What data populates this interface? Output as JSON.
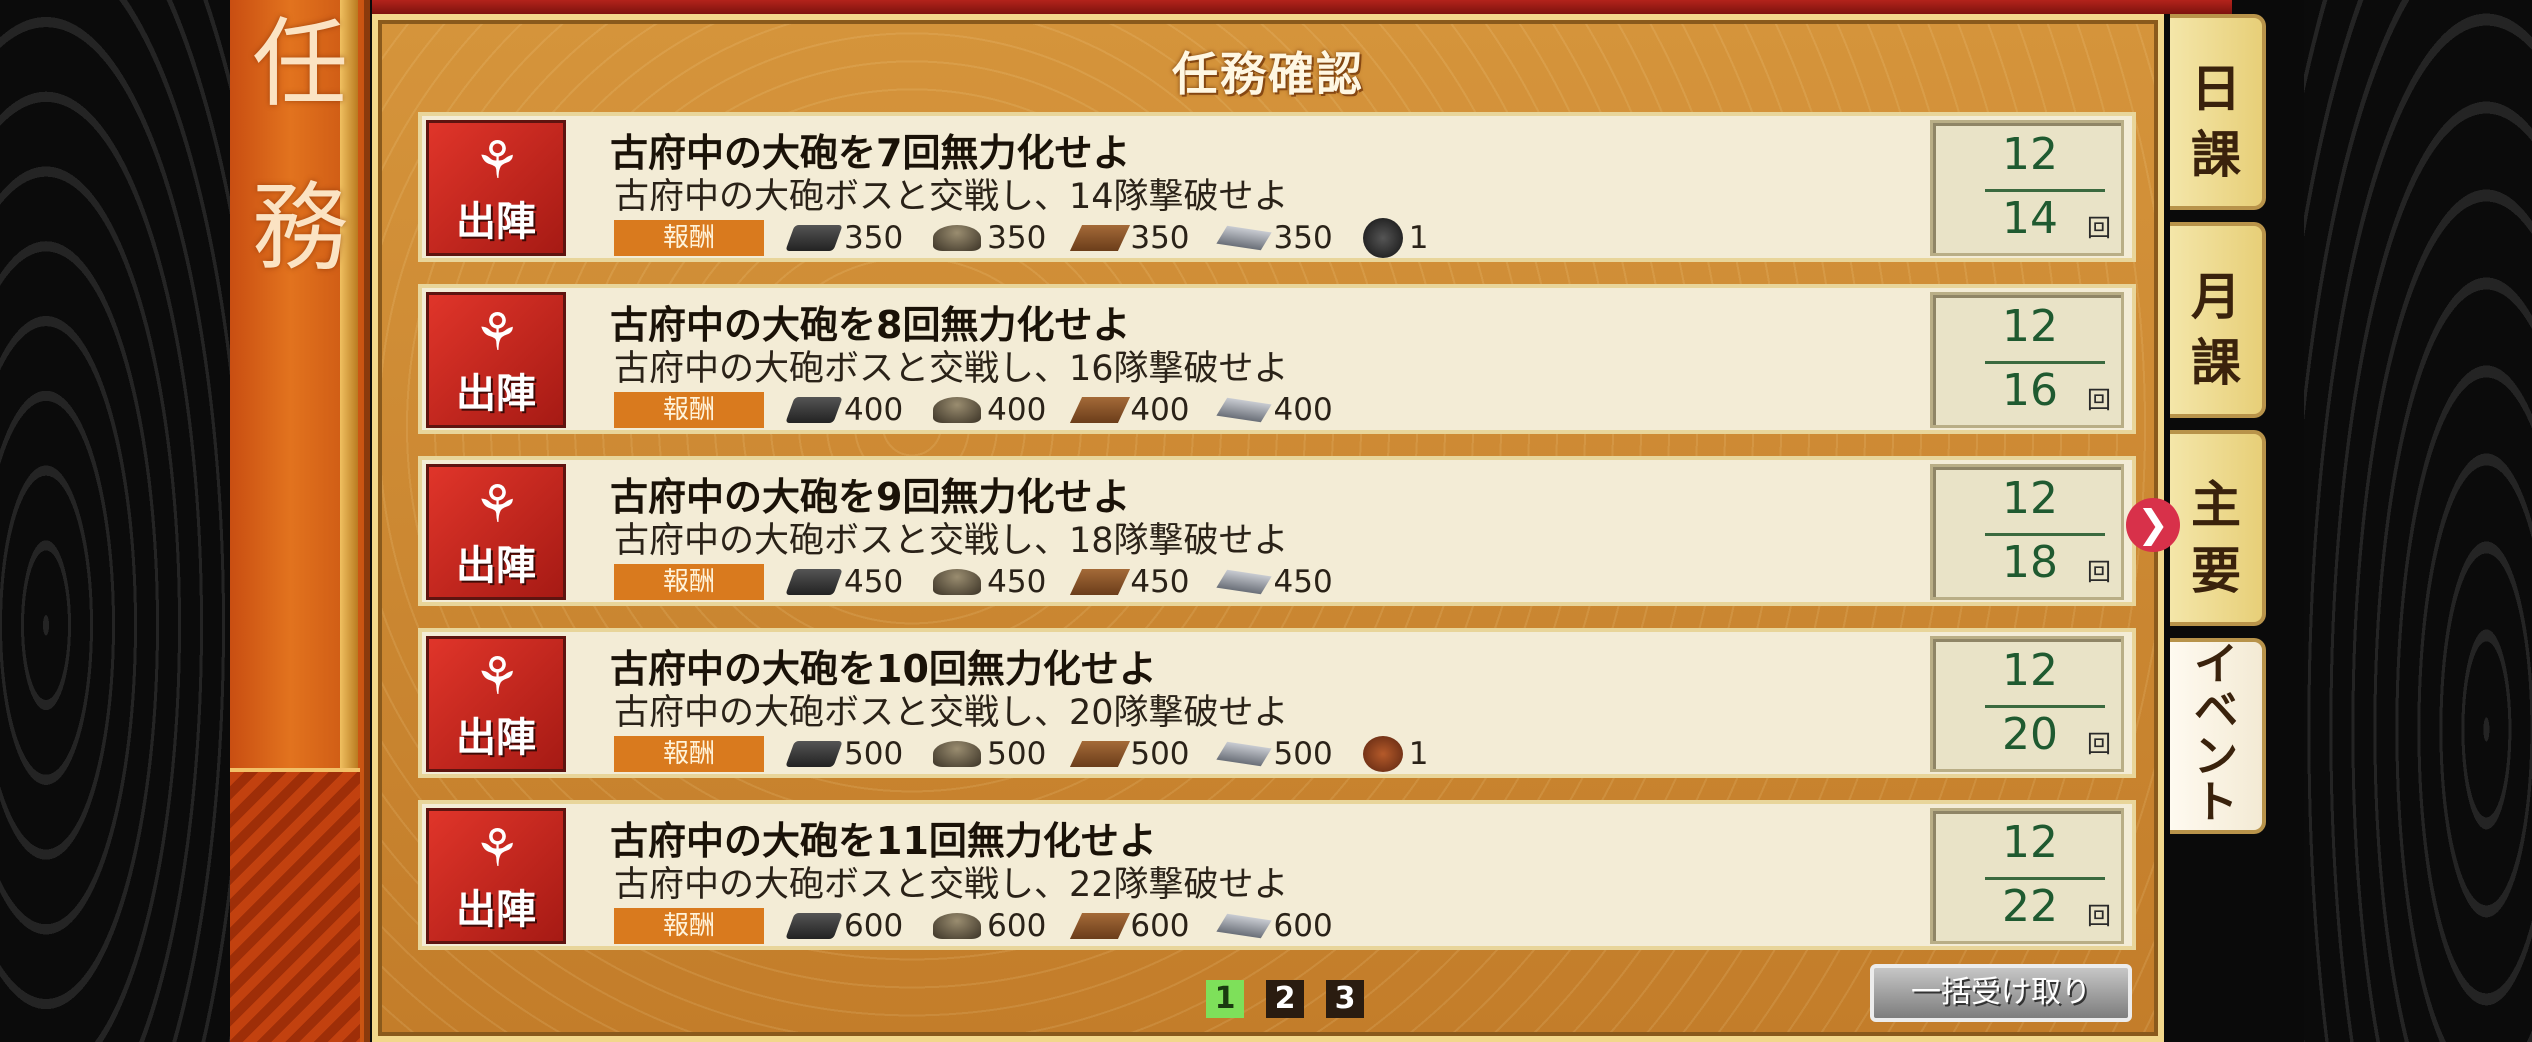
{
  "side_banner": {
    "chars": [
      "任",
      "務"
    ]
  },
  "panel": {
    "title": "任務確認"
  },
  "reward_label": "報酬",
  "badge_text": "出陣",
  "missions": [
    {
      "title": "古府中の大砲を7回無力化せよ",
      "desc": "古府中の大砲ボスと交戦し、14隊撃破せよ",
      "rewards": {
        "steel": "350",
        "coal": "350",
        "wood": "350",
        "iron": "350",
        "extra_count": "1"
      },
      "progress": {
        "current": "12",
        "target": "14",
        "unit": "回"
      }
    },
    {
      "title": "古府中の大砲を8回無力化せよ",
      "desc": "古府中の大砲ボスと交戦し、16隊撃破せよ",
      "rewards": {
        "steel": "400",
        "coal": "400",
        "wood": "400",
        "iron": "400"
      },
      "progress": {
        "current": "12",
        "target": "16",
        "unit": "回"
      }
    },
    {
      "title": "古府中の大砲を9回無力化せよ",
      "desc": "古府中の大砲ボスと交戦し、18隊撃破せよ",
      "rewards": {
        "steel": "450",
        "coal": "450",
        "wood": "450",
        "iron": "450"
      },
      "progress": {
        "current": "12",
        "target": "18",
        "unit": "回"
      }
    },
    {
      "title": "古府中の大砲を10回無力化せよ",
      "desc": "古府中の大砲ボスと交戦し、20隊撃破せよ",
      "rewards": {
        "steel": "500",
        "coal": "500",
        "wood": "500",
        "iron": "500",
        "extra_count": "1"
      },
      "progress": {
        "current": "12",
        "target": "20",
        "unit": "回"
      }
    },
    {
      "title": "古府中の大砲を11回無力化せよ",
      "desc": "古府中の大砲ボスと交戦し、22隊撃破せよ",
      "rewards": {
        "steel": "600",
        "coal": "600",
        "wood": "600",
        "iron": "600"
      },
      "progress": {
        "current": "12",
        "target": "22",
        "unit": "回"
      }
    }
  ],
  "pager": {
    "pages": [
      "1",
      "2",
      "3"
    ],
    "active": "1"
  },
  "bulk_button": "一括受け取り",
  "tabs": {
    "daily": [
      "日",
      "課"
    ],
    "monthly": [
      "月",
      "課"
    ],
    "main": [
      "主",
      "要"
    ],
    "event": [
      "イ",
      "ベ",
      "ン",
      "ト"
    ]
  },
  "tab_arrow": "❯",
  "colors": {
    "panel": "#c98632",
    "reward_tag": "#d97a1e",
    "badge": "#c62a22",
    "counter_text": "#1f5a30",
    "active_page": "#7ee05a"
  }
}
